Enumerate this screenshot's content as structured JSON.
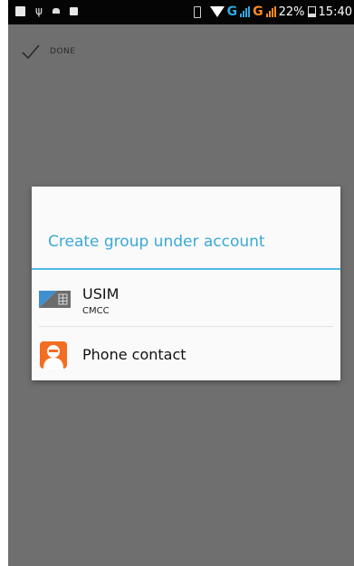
{
  "status_bar": {
    "network_type_1": "G",
    "network_type_2": "G",
    "battery": "22%",
    "time": "15:40"
  },
  "action_bar": {
    "done_label": "DONE"
  },
  "dialog": {
    "title": "Create group under account",
    "items": [
      {
        "title": "USIM",
        "subtitle": "CMCC",
        "icon": "sim-card-icon"
      },
      {
        "title": "Phone contact",
        "icon": "contact-person-icon"
      }
    ]
  },
  "colors": {
    "accent": "#3aa8d8",
    "divider": "#52b8e8",
    "contact_icon_bg": "#f46d22",
    "dim_background": "#6f6f6f",
    "status_bar": "#050505"
  }
}
